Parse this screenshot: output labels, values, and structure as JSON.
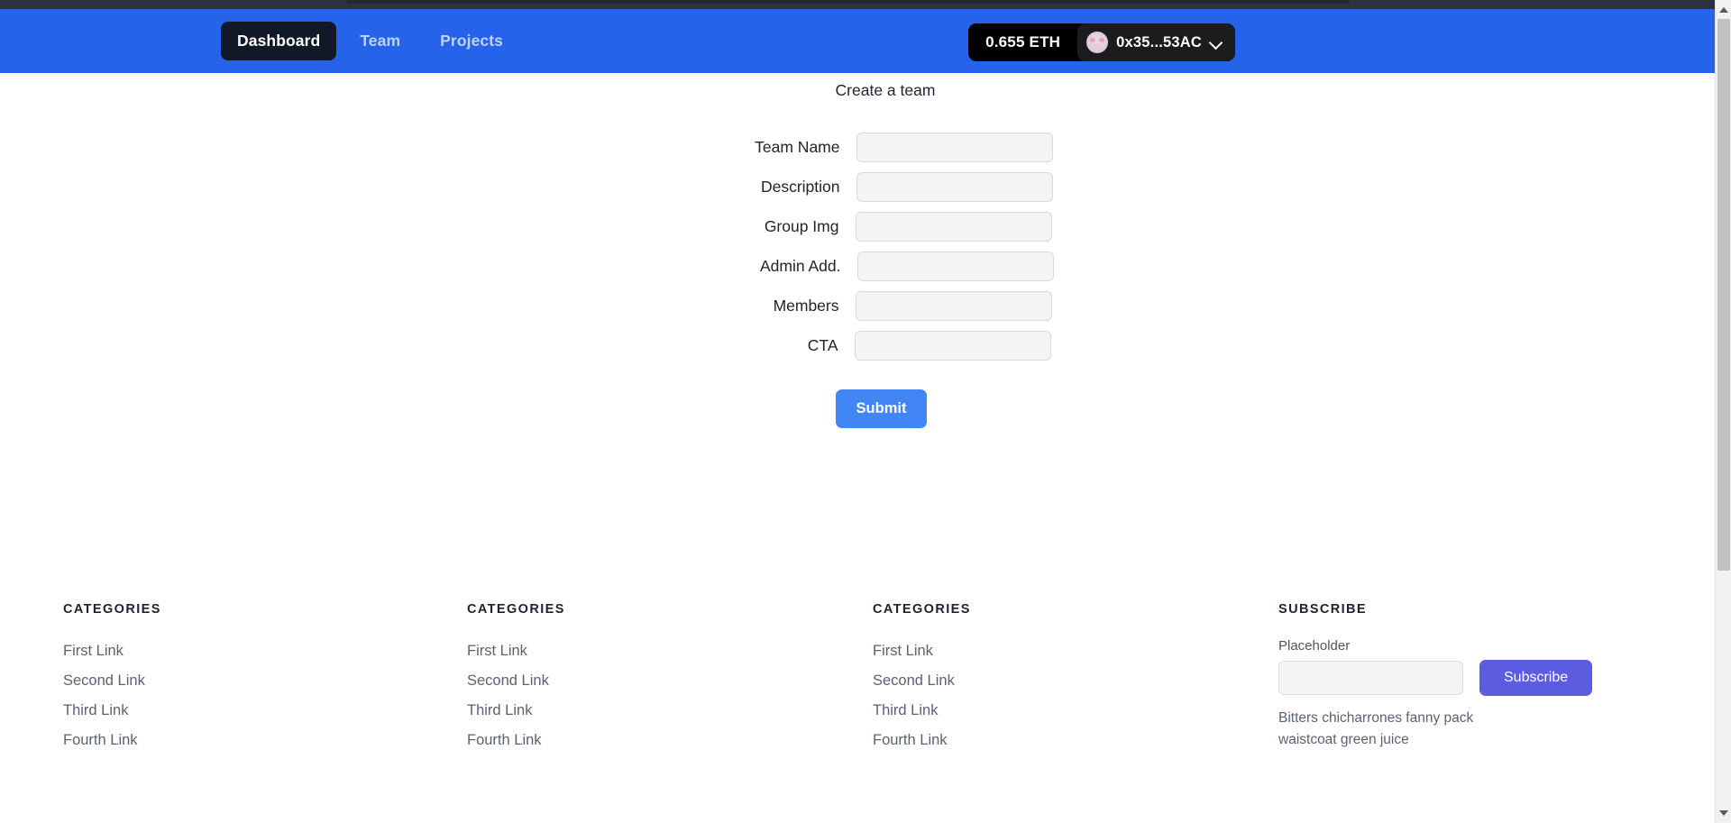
{
  "browser": {
    "scrollbar": {
      "up_icon": "scroll-up-arrow-icon",
      "down_icon": "scroll-down-arrow-icon"
    }
  },
  "navbar": {
    "accent_color": "#2563eb",
    "active_pill_color": "#111827",
    "links": [
      {
        "label": "Dashboard",
        "active": true
      },
      {
        "label": "Team",
        "active": false
      },
      {
        "label": "Projects",
        "active": false
      }
    ],
    "wallet": {
      "balance": "0.655 ETH",
      "address": "0x35...53AC",
      "avatar_icon": "wallet-avatar-icon",
      "chevron_icon": "chevron-down-icon",
      "background_color": "#000000"
    }
  },
  "main": {
    "title": "Create a team",
    "fields": [
      {
        "label": "Team Name",
        "value": "",
        "placeholder": ""
      },
      {
        "label": "Description",
        "value": "",
        "placeholder": ""
      },
      {
        "label": "Group Img",
        "value": "",
        "placeholder": ""
      },
      {
        "label": "Admin Add.",
        "value": "",
        "placeholder": ""
      },
      {
        "label": "Members",
        "value": "",
        "placeholder": ""
      },
      {
        "label": "CTA",
        "value": "",
        "placeholder": ""
      }
    ],
    "submit_label": "Submit",
    "submit_color": "#4285f4"
  },
  "footer": {
    "columns": [
      {
        "heading": "CATEGORIES",
        "links": [
          "First Link",
          "Second Link",
          "Third Link",
          "Fourth Link"
        ]
      },
      {
        "heading": "CATEGORIES",
        "links": [
          "First Link",
          "Second Link",
          "Third Link",
          "Fourth Link"
        ]
      },
      {
        "heading": "CATEGORIES",
        "links": [
          "First Link",
          "Second Link",
          "Third Link",
          "Fourth Link"
        ]
      }
    ],
    "subscribe": {
      "heading": "SUBSCRIBE",
      "field_label": "Placeholder",
      "input_value": "",
      "input_placeholder": "",
      "button_label": "Subscribe",
      "button_color": "#5c5ce0",
      "note": "Bitters chicharrones fanny pack waistcoat green juice"
    }
  }
}
